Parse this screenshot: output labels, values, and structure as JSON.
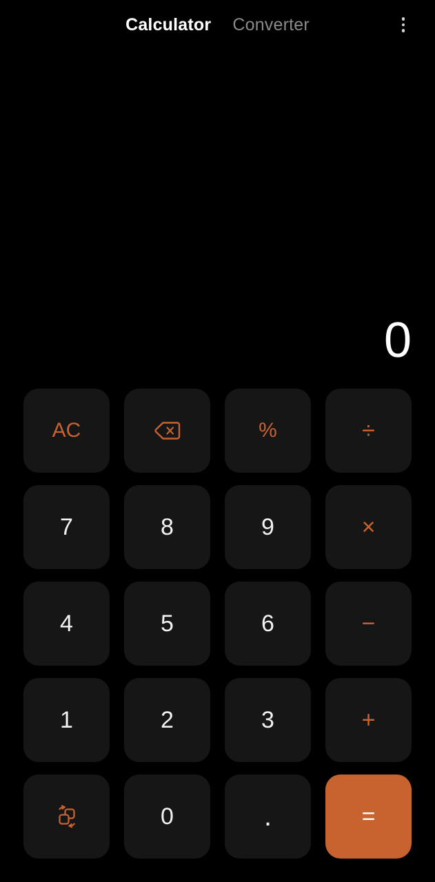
{
  "app": {
    "name": "Calculator",
    "theme": "dark",
    "background_color": "#000000",
    "key_background_color": "#161616",
    "accent_color": "#c8632f",
    "digit_text_color": "#f2f2f2",
    "inactive_tab_color": "#8a8a8a"
  },
  "header": {
    "tabs": [
      {
        "label": "Calculator",
        "active": true
      },
      {
        "label": "Converter",
        "active": false
      }
    ],
    "overflow_menu": {
      "icon": "more-vertical-icon",
      "label": "More options"
    }
  },
  "display": {
    "expression": "",
    "result": "0"
  },
  "keypad": {
    "rows": [
      [
        {
          "id": "all-clear",
          "label": "AC",
          "kind": "func",
          "icon": null
        },
        {
          "id": "backspace",
          "label": "",
          "kind": "func",
          "icon": "backspace-icon"
        },
        {
          "id": "percent",
          "label": "%",
          "kind": "func",
          "icon": null
        },
        {
          "id": "divide",
          "label": "÷",
          "kind": "op",
          "icon": null
        }
      ],
      [
        {
          "id": "seven",
          "label": "7",
          "kind": "digit",
          "icon": null
        },
        {
          "id": "eight",
          "label": "8",
          "kind": "digit",
          "icon": null
        },
        {
          "id": "nine",
          "label": "9",
          "kind": "digit",
          "icon": null
        },
        {
          "id": "multiply",
          "label": "×",
          "kind": "op",
          "icon": null
        }
      ],
      [
        {
          "id": "four",
          "label": "4",
          "kind": "digit",
          "icon": null
        },
        {
          "id": "five",
          "label": "5",
          "kind": "digit",
          "icon": null
        },
        {
          "id": "six",
          "label": "6",
          "kind": "digit",
          "icon": null
        },
        {
          "id": "subtract",
          "label": "−",
          "kind": "op",
          "icon": null
        }
      ],
      [
        {
          "id": "one",
          "label": "1",
          "kind": "digit",
          "icon": null
        },
        {
          "id": "two",
          "label": "2",
          "kind": "digit",
          "icon": null
        },
        {
          "id": "three",
          "label": "3",
          "kind": "digit",
          "icon": null
        },
        {
          "id": "add",
          "label": "+",
          "kind": "op",
          "icon": null
        }
      ],
      [
        {
          "id": "unit-convert",
          "label": "",
          "kind": "func",
          "icon": "convert-units-icon"
        },
        {
          "id": "zero",
          "label": "0",
          "kind": "digit",
          "icon": null
        },
        {
          "id": "decimal-point",
          "label": ".",
          "kind": "dot",
          "icon": null
        },
        {
          "id": "equals",
          "label": "=",
          "kind": "equals",
          "icon": null
        }
      ]
    ]
  }
}
